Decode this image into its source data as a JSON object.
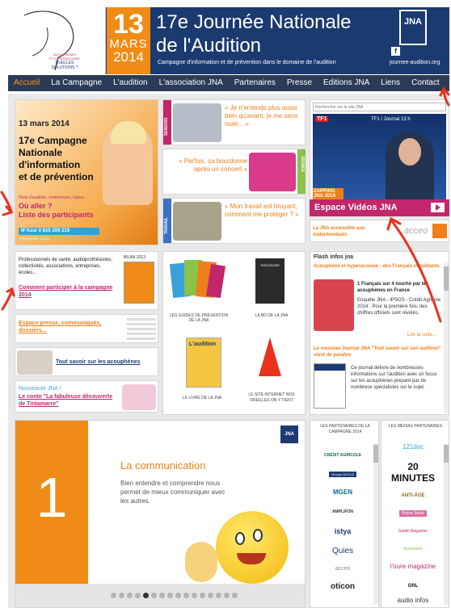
{
  "header": {
    "day": "13",
    "month": "MARS",
    "year": "2014",
    "title_line1": "17e Journée Nationale",
    "title_line2": "de l'Audition",
    "subtitle": "Campagne d'information et de prévention dans le domaine de l'audition",
    "jna_logo": "JNA",
    "url": "journee-audition.org",
    "logo_text1": "ACOUPHÈNES",
    "logo_text2": "ET HYPERACOUSIE",
    "logo_text3": "QUELLES",
    "logo_text4": "SOLUTIONS ?"
  },
  "nav": [
    "Accueil",
    "La Campagne",
    "L'audition",
    "L'association JNA",
    "Partenaires",
    "Presse",
    "Editions JNA",
    "Liens",
    "Contact"
  ],
  "promo": {
    "date": "13 mars 2014",
    "line1": "17e Campagne",
    "line2": "Nationale",
    "line3": "d'information",
    "line4": "et de prévention",
    "small": "Tests d'audition, conférences, expos...",
    "where1": "Où aller ?",
    "where2": "Liste des participants",
    "azur": "N°Azur 0 810 200 219",
    "azur_small": "PRIX APPEL LOCAL"
  },
  "themes": [
    {
      "band": "SENIORS",
      "quote": "« Je n'entends plus aussi bien qu'avant, je me sens isolé... »"
    },
    {
      "band": "JEUNES",
      "quote": "« Parfois, ça bourdonne après un concert »"
    },
    {
      "band": "TRAVAIL",
      "quote": "« Mon travail est bruyant, comment me protéger ? »"
    }
  ],
  "search": {
    "placeholder": "Rechercher sur le site JNA"
  },
  "video": {
    "caption": "TF1 / Journal 13 h",
    "tf1": "TF1",
    "zapping": "ZAPPING JNA 2014"
  },
  "espace": "Espace Vidéos JNA",
  "accessible": {
    "text": "La JNA accessible aux malentendants",
    "brand": "acceo"
  },
  "left_boxes": {
    "pros": "Professionnels de santé, audioprothésistes, collectivités, associations, entreprises, écoles...",
    "bilan": "BILAN 2013",
    "participate": "Comment participer à la campagne 2014",
    "press": "Espace presse, communiqués, dossiers...",
    "acouphenes": "Tout savoir sur les acouphènes",
    "nouveaute": "Nouveauté JNA !",
    "conte": "Le conte \"La fabuleuse découverte de Tintamarre\""
  },
  "middle": {
    "guides": "LES GUIDES DE PRÉVENTION DE LA JNA",
    "bd": "LA BD DE LA JNA",
    "livre": "LE LIVRE DE LA JNA",
    "livre_cover": "L'audition",
    "site": "LE SITE INTERNET NOS OREILLES ON Y TIENT",
    "bd_cover": "THÉLÉSOPE"
  },
  "flash": {
    "heading": "Flash infos jna",
    "item1_title": "Acouphène et hyperacousie : des Français inquiétants",
    "item1_sub": "1 Français sur 4 touché par les acouphènes en France",
    "item1_body": "Enquête JNA - IPSOS - Crédit Agricole 2014 : Pour la première fois, des chiffres officiels sont révélés.",
    "readmore": "Lire la suite...",
    "item2_title": "Le nouveau Journal JNA \"Tout savoir sur son audition\" vient de paraître",
    "item2_body": "Ce journal délivre de nombreuses informations sur l'audition avec un focus sur les acouphènes préparé par de nombreux spécialistes sur le sujet."
  },
  "slider": {
    "number": "1",
    "title": "La communication",
    "text": "Bien entendre et comprendre nous permet de mieux communiquer avec les autres.",
    "jna": "JNA"
  },
  "partners": {
    "heading": "LES PARTENAIRES DE LA CAMPAGNE 2014",
    "items": [
      "CRÉDIT AGRICOLE",
      "Groupe ACCLG",
      "MGEN",
      "AMPLIFON",
      "istya",
      "Quies",
      "acceo",
      "oticon"
    ]
  },
  "medias": {
    "heading": "LES MÉDIAS PARTENAIRES",
    "items": [
      "121doc",
      "20 MINUTES",
      "ANTI-ÂGE",
      "Pleine Santé",
      "Santé Magazine",
      "doctissimo",
      "l'oure magazine",
      "ORL",
      "audio infos"
    ]
  },
  "colors": {
    "navy": "#1b3a70",
    "orange": "#ef8b16",
    "magenta": "#c2266b",
    "red_arrow": "#e8321e"
  }
}
